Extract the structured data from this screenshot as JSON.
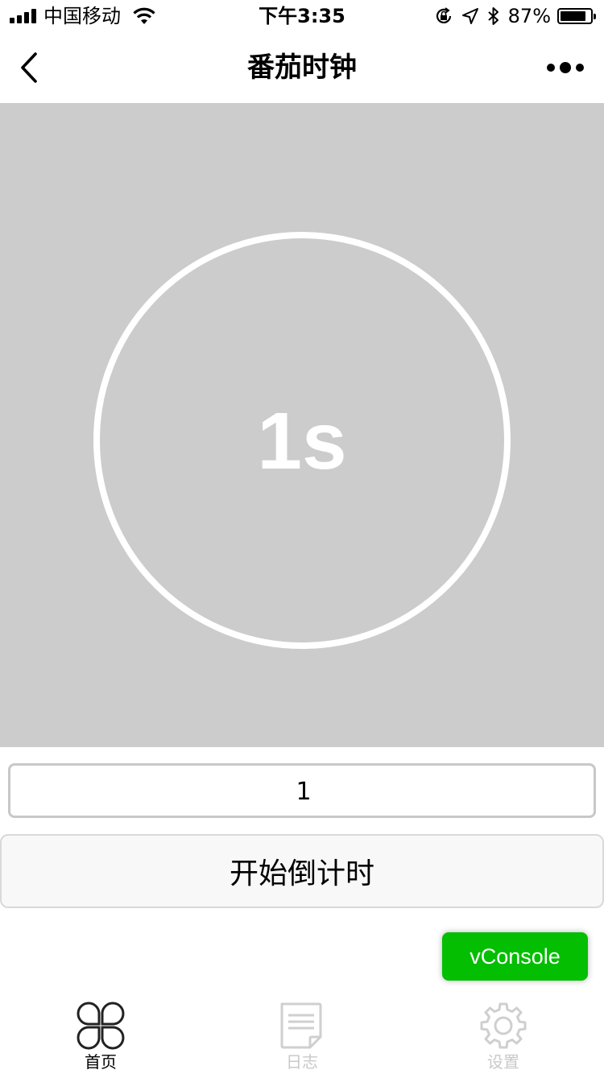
{
  "status_bar": {
    "carrier": "中国移动",
    "time": "下午3:35",
    "battery_percent": "87%",
    "battery_level": 0.87
  },
  "nav": {
    "title": "番茄时钟",
    "back_icon": "chevron-left-icon",
    "more_icon": "more-dots-icon"
  },
  "timer": {
    "display": "1s",
    "ring_color": "#ffffff",
    "background_color": "#cccccc"
  },
  "form": {
    "seconds_value": "1",
    "start_button_label": "开始倒计时"
  },
  "vconsole": {
    "label": "vConsole",
    "color": "#04be02"
  },
  "tab_bar": {
    "tabs": [
      {
        "label": "首页",
        "icon": "clover-icon",
        "active": true
      },
      {
        "label": "日志",
        "icon": "document-icon",
        "active": false
      },
      {
        "label": "设置",
        "icon": "gear-icon",
        "active": false
      }
    ]
  }
}
